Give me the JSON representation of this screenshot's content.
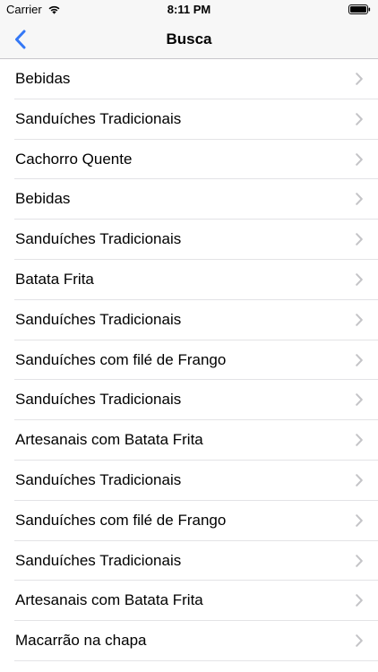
{
  "status_bar": {
    "carrier": "Carrier",
    "time": "8:11 PM"
  },
  "nav": {
    "title": "Busca",
    "back_icon": "chevron-left-icon",
    "accent_color": "#3478f6"
  },
  "list": {
    "items": [
      {
        "label": "Bebidas"
      },
      {
        "label": "Sanduíches Tradicionais"
      },
      {
        "label": "Cachorro Quente"
      },
      {
        "label": "Bebidas"
      },
      {
        "label": "Sanduíches Tradicionais"
      },
      {
        "label": "Batata Frita"
      },
      {
        "label": "Sanduíches Tradicionais"
      },
      {
        "label": "Sanduíches com filé de Frango"
      },
      {
        "label": "Sanduíches Tradicionais"
      },
      {
        "label": "Artesanais com Batata Frita"
      },
      {
        "label": "Sanduíches Tradicionais"
      },
      {
        "label": "Sanduíches com filé de Frango"
      },
      {
        "label": "Sanduíches Tradicionais"
      },
      {
        "label": "Artesanais com Batata Frita"
      },
      {
        "label": "Macarrão na chapa"
      },
      {
        "label": ""
      }
    ]
  }
}
